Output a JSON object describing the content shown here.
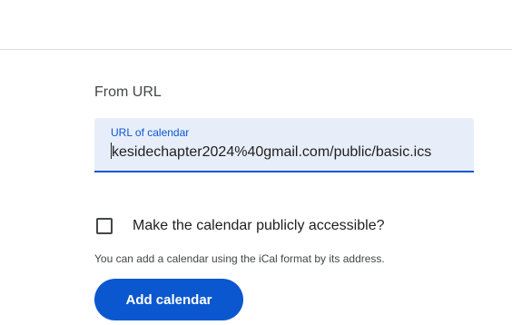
{
  "section": {
    "title": "From URL"
  },
  "url_field": {
    "label": "URL of calendar",
    "value": "kesidechapter2024%40gmail.com/public/basic.ics"
  },
  "public_option": {
    "label": "Make the calendar publicly accessible?",
    "checked": false
  },
  "help_text": "You can add a calendar using the iCal format by its address.",
  "actions": {
    "add_label": "Add calendar"
  },
  "colors": {
    "accent": "#0b57d0",
    "field_background": "#e8eef9",
    "divider": "#dadce0"
  }
}
